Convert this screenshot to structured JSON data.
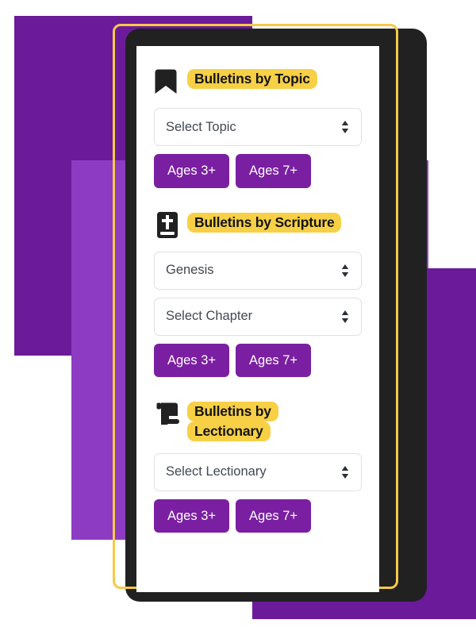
{
  "colors": {
    "purple_dark": "#6B1B9A",
    "purple_light": "#8E3BC4",
    "button_purple": "#7A1FA2",
    "highlight_yellow": "#F7D046",
    "frame_yellow": "#F7C948",
    "black_card": "#212121",
    "panel_white": "#FFFFFF",
    "select_text": "#424851",
    "select_border": "#DDE1E6"
  },
  "panel": {
    "sections": [
      {
        "id": "topic",
        "icon": "bookmark-icon",
        "heading_lines": [
          "Bulletins by Topic"
        ],
        "selects": [
          {
            "name": "topic-select",
            "value": "Select Topic"
          }
        ],
        "buttons": [
          {
            "name": "ages-3-plus-button",
            "label": "Ages 3+"
          },
          {
            "name": "ages-7-plus-button",
            "label": "Ages 7+"
          }
        ]
      },
      {
        "id": "scripture",
        "icon": "bible-icon",
        "heading_lines": [
          "Bulletins by Scripture"
        ],
        "selects": [
          {
            "name": "scripture-book-select",
            "value": "Genesis"
          },
          {
            "name": "scripture-chapter-select",
            "value": "Select Chapter"
          }
        ],
        "buttons": [
          {
            "name": "ages-3-plus-button",
            "label": "Ages 3+"
          },
          {
            "name": "ages-7-plus-button",
            "label": "Ages 7+"
          }
        ]
      },
      {
        "id": "lectionary",
        "icon": "scroll-icon",
        "heading_lines": [
          "Bulletins by",
          "Lectionary"
        ],
        "selects": [
          {
            "name": "lectionary-select",
            "value": "Select Lectionary"
          }
        ],
        "buttons": [
          {
            "name": "ages-3-plus-button",
            "label": "Ages 3+"
          },
          {
            "name": "ages-7-plus-button",
            "label": "Ages 7+"
          }
        ]
      }
    ]
  }
}
